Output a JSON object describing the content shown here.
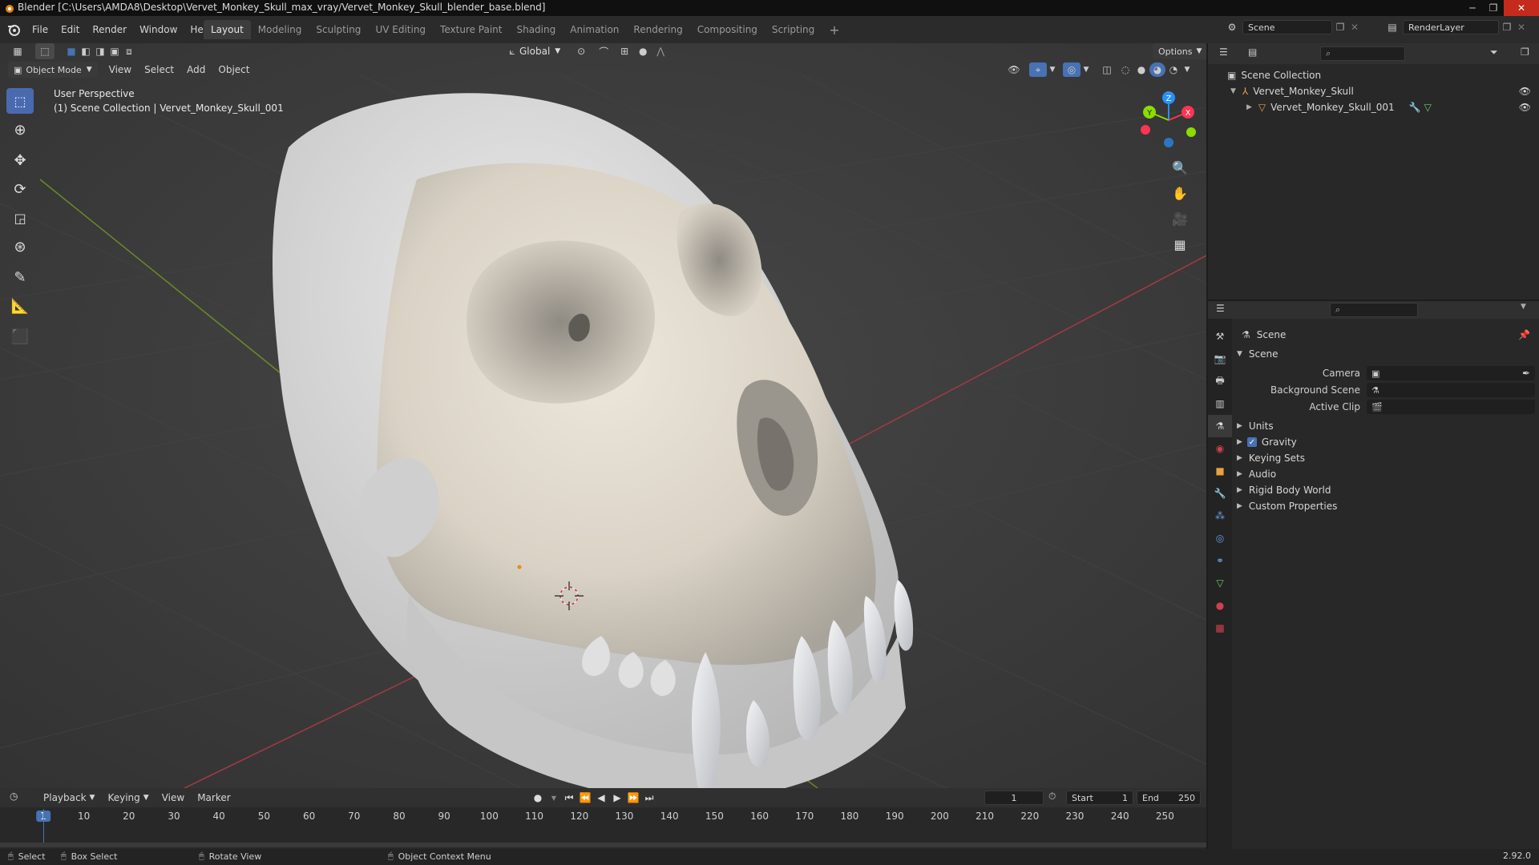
{
  "window": {
    "title": "Blender [C:\\Users\\AMDA8\\Desktop\\Vervet_Monkey_Skull_max_vray/Vervet_Monkey_Skull_blender_base.blend]"
  },
  "menu": [
    "File",
    "Edit",
    "Render",
    "Window",
    "Help"
  ],
  "workspaces": [
    "Layout",
    "Modeling",
    "Sculpting",
    "UV Editing",
    "Texture Paint",
    "Shading",
    "Animation",
    "Rendering",
    "Compositing",
    "Scripting"
  ],
  "topbar": {
    "scene_name": "Scene",
    "render_layer": "RenderLayer",
    "add_tab": "+"
  },
  "viewport": {
    "mode": "Object Mode",
    "menus": [
      "View",
      "Select",
      "Add",
      "Object"
    ],
    "transform_orientation": "Global",
    "options_label": "Options",
    "info_line1": "User Perspective",
    "info_line2": "(1) Scene Collection | Vervet_Monkey_Skull_001",
    "gizmo_axes": {
      "x": "X",
      "y": "Y",
      "z": "Z"
    }
  },
  "outliner": {
    "root": "Scene Collection",
    "items": [
      "Vervet_Monkey_Skull",
      "Vervet_Monkey_Skull_001"
    ]
  },
  "properties": {
    "context_title": "Scene",
    "panel_title": "Scene",
    "fields": {
      "camera": "Camera",
      "background_scene": "Background Scene",
      "active_clip": "Active Clip"
    },
    "subpanels": [
      "Units",
      "Gravity",
      "Keying Sets",
      "Audio",
      "Rigid Body World",
      "Custom Properties"
    ]
  },
  "timeline": {
    "menus": [
      "Playback",
      "Keying",
      "View",
      "Marker"
    ],
    "current_frame": "1",
    "start_label": "Start",
    "start_value": "1",
    "end_label": "End",
    "end_value": "250",
    "ticks": [
      "1",
      "10",
      "20",
      "30",
      "40",
      "50",
      "60",
      "70",
      "80",
      "90",
      "100",
      "110",
      "120",
      "130",
      "140",
      "150",
      "160",
      "170",
      "180",
      "190",
      "200",
      "210",
      "220",
      "230",
      "240",
      "250"
    ]
  },
  "statusbar": {
    "select": "Select",
    "box_select": "Box Select",
    "rotate_view": "Rotate View",
    "context_menu": "Object Context Menu",
    "version": "2.92.0"
  },
  "colors": {
    "accent_blue": "#4772b3",
    "axis_x": "#ff3352",
    "axis_y": "#8bdc00",
    "axis_z": "#2890ff"
  }
}
